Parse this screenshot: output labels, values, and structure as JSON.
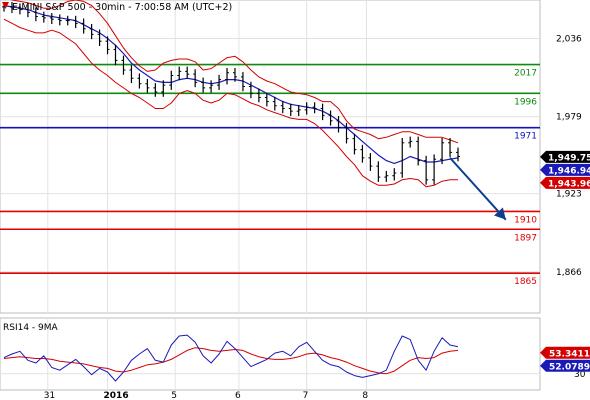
{
  "header": {
    "title": "E-MINI S&P 500 - 30min - 7:00:58 AM (UTC+2)",
    "symbol_icon": "down-arrow-icon"
  },
  "colors": {
    "background": "#ffffff",
    "grid": "#e2e2e2",
    "price_bars": "#000000",
    "bollinger": "#d40000",
    "moving_average": "#1a1ab8",
    "green_level": "#118a11",
    "blue_level": "#1010c0",
    "red_level": "#e00000",
    "forecast_arrow": "#0b3f8c",
    "rsi": "#1a1ab8",
    "rsi_ma": "#d40000"
  },
  "chart_data": [
    {
      "type": "line",
      "title": "E-MINI S&P 500 - 30min - 7:00:58 AM (UTC+2)",
      "ylim": [
        1836,
        2064
      ],
      "y_ticks": [
        "2,036",
        "1,979",
        "1,923",
        "1,866"
      ],
      "x_tick_labels": [
        "31",
        "2016",
        "5",
        "6",
        "7",
        "8"
      ],
      "grid": true,
      "series": [
        {
          "kind": "ohlc",
          "closes": [
            2059,
            2058,
            2057,
            2055,
            2052,
            2051,
            2050,
            2049,
            2049,
            2047,
            2043,
            2039,
            2034,
            2028,
            2020,
            2013,
            2007,
            2003,
            2000,
            1997,
            2002,
            2009,
            2012,
            2010,
            2004,
            2000,
            2002,
            2006,
            2011,
            2008,
            2001,
            1996,
            1993,
            1990,
            1987,
            1985,
            1983,
            1984,
            1986,
            1985,
            1980,
            1976,
            1971,
            1963,
            1955,
            1949,
            1943,
            1935,
            1936,
            1938,
            1960,
            1961,
            1947,
            1933,
            1948,
            1960,
            1953,
            1950
          ]
        },
        {
          "name": "Bollinger upper",
          "kind": "band",
          "values": [
            2066,
            2064,
            2063,
            2062,
            2060,
            2058,
            2058,
            2060,
            2063,
            2064,
            2063,
            2060,
            2054,
            2047,
            2038,
            2029,
            2022,
            2016,
            2012,
            2013,
            2018,
            2020,
            2021,
            2021,
            2019,
            2013,
            2014,
            2018,
            2022,
            2023,
            2019,
            2013,
            2008,
            2005,
            2003,
            2000,
            1997,
            1996,
            1995,
            1993,
            1990,
            1990,
            1985,
            1976,
            1970,
            1968,
            1966,
            1963,
            1964,
            1966,
            1968,
            1968,
            1966,
            1964,
            1964,
            1964,
            1962,
            1960
          ]
        },
        {
          "name": "Bollinger lower",
          "kind": "band",
          "values": [
            2050,
            2047,
            2044,
            2042,
            2040,
            2040,
            2042,
            2040,
            2036,
            2032,
            2025,
            2018,
            2013,
            2009,
            2004,
            2000,
            1996,
            1993,
            1989,
            1985,
            1985,
            1989,
            1996,
            1998,
            1996,
            1991,
            1989,
            1991,
            1996,
            1995,
            1992,
            1989,
            1987,
            1984,
            1982,
            1980,
            1978,
            1977,
            1977,
            1974,
            1969,
            1963,
            1957,
            1950,
            1944,
            1936,
            1932,
            1929,
            1929,
            1930,
            1933,
            1934,
            1933,
            1928,
            1929,
            1932,
            1933,
            1933
          ]
        },
        {
          "name": "Moving average",
          "kind": "ma",
          "values": [
            2060,
            2059,
            2058,
            2057,
            2055,
            2053,
            2052,
            2051,
            2050,
            2049,
            2046,
            2043,
            2040,
            2036,
            2031,
            2025,
            2018,
            2013,
            2009,
            2005,
            2004,
            2004,
            2006,
            2007,
            2006,
            2004,
            2003,
            2004,
            2006,
            2006,
            2005,
            2002,
            1999,
            1996,
            1993,
            1990,
            1988,
            1987,
            1986,
            1985,
            1983,
            1980,
            1976,
            1971,
            1966,
            1961,
            1956,
            1951,
            1947,
            1945,
            1947,
            1950,
            1948,
            1946,
            1946,
            1947,
            1948,
            1949
          ]
        }
      ],
      "levels": [
        {
          "value": 2017,
          "label": "2017",
          "color": "green"
        },
        {
          "value": 1996,
          "label": "1996",
          "color": "green"
        },
        {
          "value": 1971,
          "label": "1971",
          "color": "blue"
        },
        {
          "value": 1910,
          "label": "1910",
          "color": "red"
        },
        {
          "value": 1897,
          "label": "1897",
          "color": "red"
        },
        {
          "value": 1865,
          "label": "1865",
          "color": "red"
        }
      ],
      "price_tags": [
        {
          "value": 1949.75,
          "label": "1,949.75",
          "style": "black"
        },
        {
          "value": 1946.94,
          "label": "1,946.94",
          "style": "blue"
        },
        {
          "value": 1943.96,
          "label": "1,943.96",
          "style": "red"
        }
      ],
      "forecast_arrow": {
        "from": [
          56,
          1949
        ],
        "to": [
          63,
          1904
        ]
      }
    },
    {
      "type": "line",
      "title": "RSI14 - 9MA",
      "ylim": [
        12,
        92
      ],
      "y_ticks": [
        "30"
      ],
      "grid": true,
      "series": [
        {
          "name": "RSI14",
          "values": [
            48,
            52,
            55,
            45,
            42,
            50,
            37,
            34,
            40,
            46,
            38,
            29,
            36,
            32,
            22,
            32,
            45,
            52,
            58,
            45,
            43,
            62,
            72,
            73,
            65,
            50,
            42,
            52,
            66,
            58,
            48,
            38,
            42,
            46,
            53,
            55,
            50,
            60,
            65,
            55,
            45,
            40,
            38,
            32,
            28,
            26,
            28,
            30,
            34,
            55,
            72,
            68,
            45,
            34,
            55,
            70,
            62,
            60
          ]
        },
        {
          "name": "9MA",
          "values": [
            47,
            48,
            49,
            48,
            47,
            47,
            46,
            44,
            43,
            42,
            41,
            39,
            37,
            36,
            33,
            32,
            34,
            37,
            40,
            41,
            43,
            46,
            51,
            56,
            59,
            58,
            56,
            55,
            56,
            57,
            56,
            52,
            49,
            47,
            46,
            46,
            47,
            49,
            52,
            53,
            51,
            48,
            46,
            43,
            39,
            36,
            33,
            31,
            30,
            33,
            39,
            45,
            48,
            47,
            48,
            53,
            55,
            56
          ]
        }
      ],
      "tags": [
        {
          "value": 53.3411,
          "label": "53.3411",
          "style": "red"
        },
        {
          "value": 52.0789,
          "label": "52.0789",
          "style": "blue"
        }
      ]
    }
  ]
}
